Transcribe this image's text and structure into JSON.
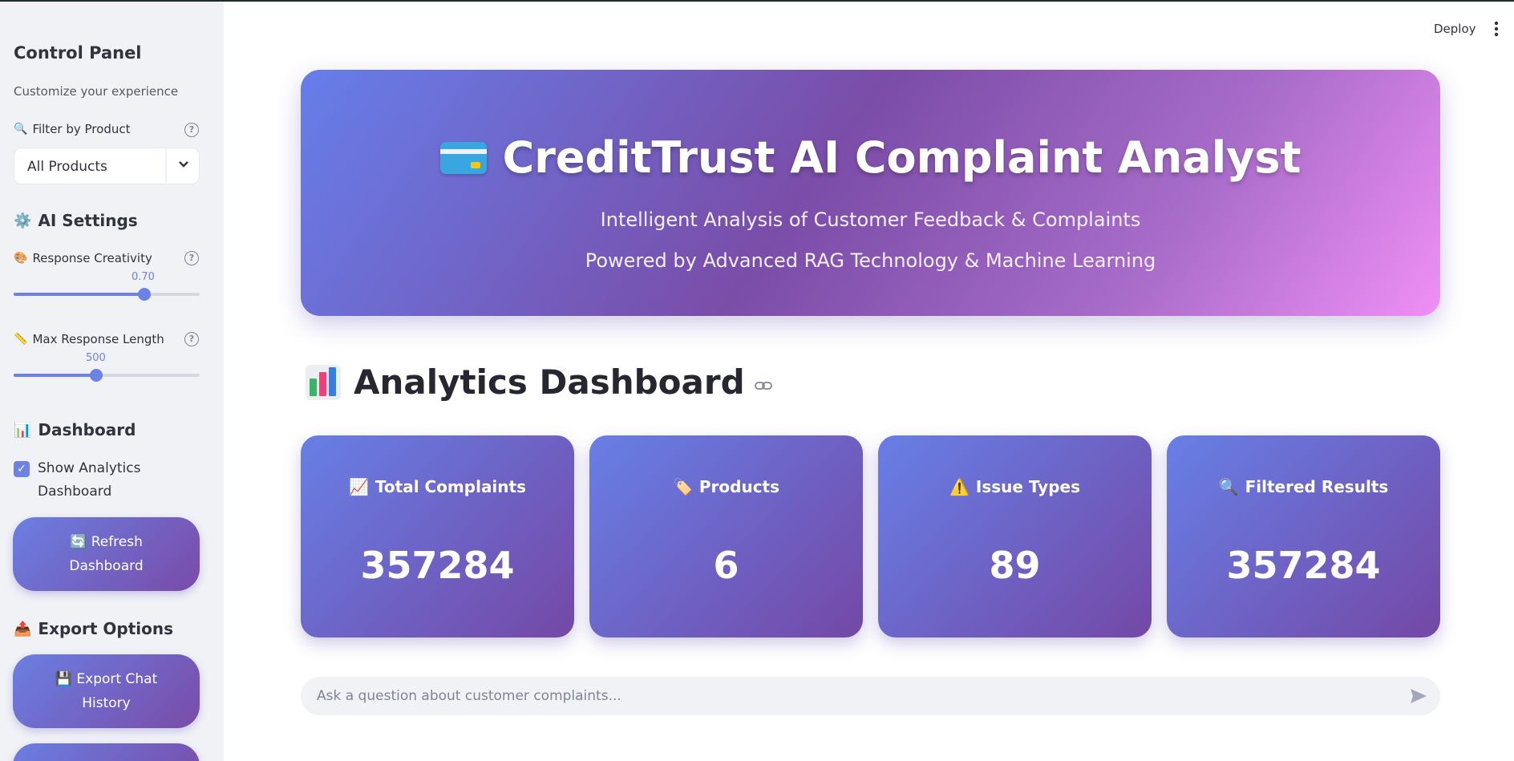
{
  "sidebar": {
    "title": "Control Panel",
    "subtitle": "Customize your experience",
    "filter": {
      "label": "Filter by Product",
      "icon": "magnifier-icon",
      "value": "All Products"
    },
    "ai_settings": {
      "heading": "AI Settings",
      "icon": "gear-icon"
    },
    "creativity": {
      "label": "Response Creativity",
      "icon": "palette-icon",
      "value": "0.70",
      "fraction": 0.7
    },
    "max_length": {
      "label": "Max Response Length",
      "icon": "ruler-icon",
      "value": "500",
      "fraction": 0.44
    },
    "dashboard": {
      "heading": "Dashboard",
      "icon": "bar-chart-icon",
      "checkbox_label": "Show Analytics Dashboard",
      "checked": true
    },
    "refresh_button": {
      "icon": "🔄",
      "label": "Refresh Dashboard"
    },
    "export": {
      "heading": "Export Options",
      "icon": "outbox-tray-icon"
    },
    "export_button": {
      "icon": "💾",
      "label": "Export Chat History"
    }
  },
  "header": {
    "deploy_label": "Deploy",
    "menu_icon": "kebab-menu-icon"
  },
  "hero": {
    "title": "CreditTrust AI Complaint Analyst",
    "subtitle1": "Intelligent Analysis of Customer Feedback & Complaints",
    "subtitle2": "Powered by Advanced RAG Technology & Machine Learning"
  },
  "analytics": {
    "title": "Analytics Dashboard"
  },
  "metrics": [
    {
      "icon": "📈",
      "label": "Total Complaints",
      "value": "357284"
    },
    {
      "icon": "🏷️",
      "label": "Products",
      "value": "6"
    },
    {
      "icon": "⚠️",
      "label": "Issue Types",
      "value": "89"
    },
    {
      "icon": "🔍",
      "label": "Filtered Results",
      "value": "357284"
    }
  ],
  "chat": {
    "placeholder": "Ask a question about customer complaints..."
  },
  "colors": {
    "accent": "#6c83e5",
    "gradient_start": "#667eea",
    "gradient_end": "#764ba2",
    "hero_end": "#f093fb"
  }
}
